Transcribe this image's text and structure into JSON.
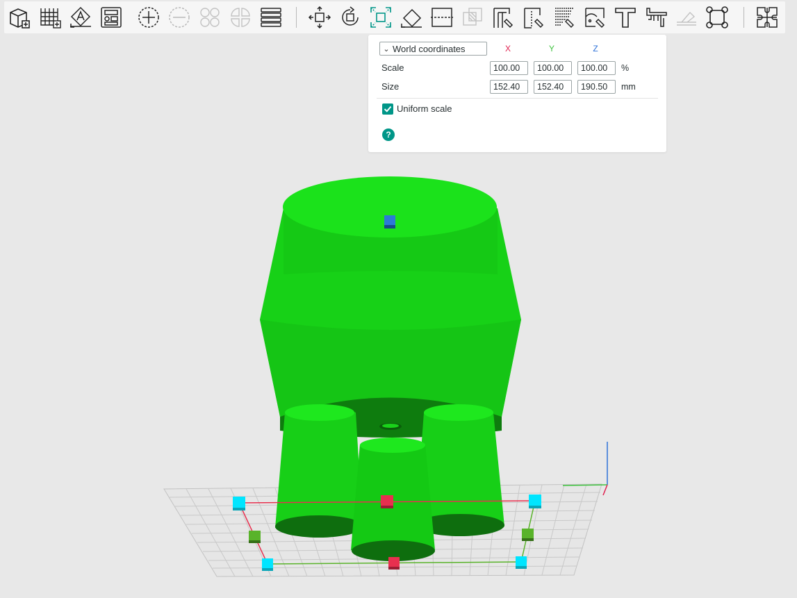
{
  "toolbar": {
    "buttons": [
      {
        "name": "add-object-button",
        "icon": "cube-plus-icon"
      },
      {
        "name": "add-plate-button",
        "icon": "grid-plus-icon"
      },
      {
        "name": "auto-orient-button",
        "icon": "orient-a-icon"
      },
      {
        "name": "arrange-button",
        "icon": "arrange-icon"
      },
      {
        "name": "add-instance-button",
        "icon": "plus-circle-icon"
      },
      {
        "name": "remove-instance-button",
        "icon": "minus-circle-icon"
      },
      {
        "name": "split-to-objects-button",
        "icon": "split-objects-icon"
      },
      {
        "name": "split-to-parts-button",
        "icon": "split-parts-icon"
      },
      {
        "name": "layers-editing-button",
        "icon": "layers-icon"
      },
      {
        "name": "move-tool-button",
        "icon": "move-arrows-icon"
      },
      {
        "name": "rotate-tool-button",
        "icon": "rotate-icon"
      },
      {
        "name": "scale-tool-button",
        "icon": "scale-box-icon"
      },
      {
        "name": "lay-on-face-button",
        "icon": "lay-on-face-icon"
      },
      {
        "name": "cut-tool-button",
        "icon": "cut-icon"
      },
      {
        "name": "mesh-boolean-button",
        "icon": "boolean-icon"
      },
      {
        "name": "support-painting-button",
        "icon": "support-paint-icon"
      },
      {
        "name": "seam-painting-button",
        "icon": "seam-paint-icon"
      },
      {
        "name": "fuzzy-skin-button",
        "icon": "fuzzy-skin-icon"
      },
      {
        "name": "color-painting-button",
        "icon": "color-paint-icon"
      },
      {
        "name": "text-tool-button",
        "icon": "text-t-icon"
      },
      {
        "name": "measure-tool-button",
        "icon": "caliper-icon"
      },
      {
        "name": "assembly-button",
        "icon": "assembly-icon"
      },
      {
        "name": "brim-ears-button",
        "icon": "brim-ears-icon"
      },
      {
        "name": "assembly-view-button",
        "icon": "puzzle-icon"
      }
    ]
  },
  "scale_panel": {
    "coordinate_system": "World coordinates",
    "axis_labels": {
      "x": "X",
      "y": "Y",
      "z": "Z"
    },
    "axis_colors": {
      "x": "#e0204f",
      "y": "#3ec23e",
      "z": "#2a6fd8"
    },
    "scale": {
      "label": "Scale",
      "x": "100.00",
      "y": "100.00",
      "z": "100.00",
      "unit": "%"
    },
    "size": {
      "label": "Size",
      "x": "152.40",
      "y": "152.40",
      "z": "190.50",
      "unit": "mm"
    },
    "uniform_scale": {
      "label": "Uniform scale",
      "checked": true
    },
    "help_glyph": "?"
  },
  "viewport": {
    "model_color": "#1fcc1f",
    "handle_colors": {
      "corner": "#00e5ff",
      "x": "#e8304f",
      "y": "#59b32a",
      "z": "#2c7ad6"
    }
  }
}
